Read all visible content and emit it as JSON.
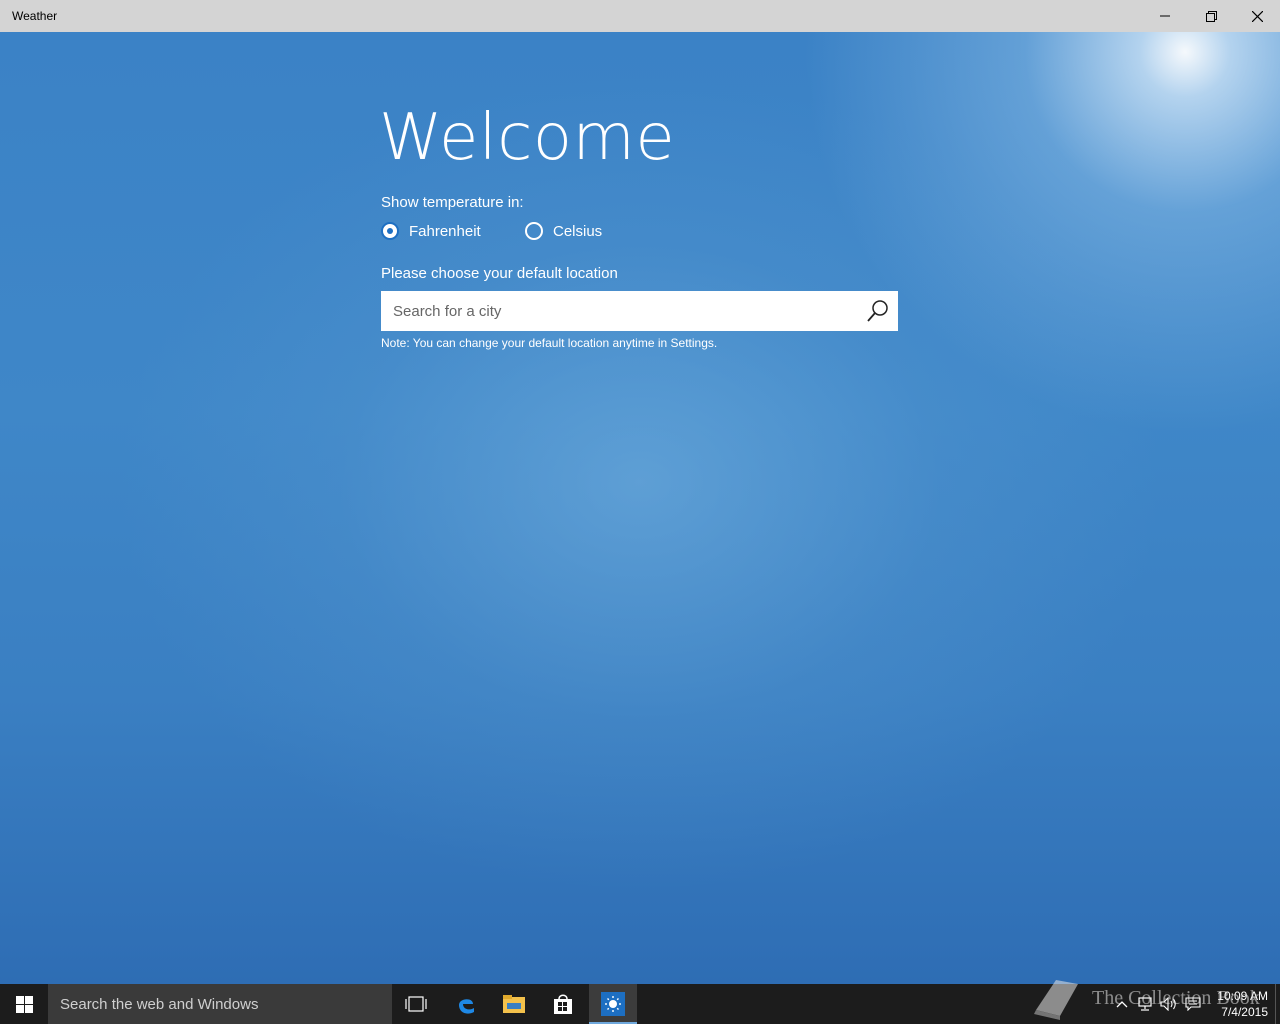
{
  "window": {
    "title": "Weather",
    "controls": {
      "minimize": "minimize-icon",
      "restore": "restore-icon",
      "close": "close-icon"
    }
  },
  "main": {
    "heading": "Welcome",
    "temperature_label": "Show temperature in:",
    "units": [
      {
        "label": "Fahrenheit",
        "selected": true
      },
      {
        "label": "Celsius",
        "selected": false
      }
    ],
    "location_label": "Please choose your default location",
    "search": {
      "placeholder": "Search for a city",
      "value": "",
      "icon": "search-icon"
    },
    "note": "Note: You can change your default location anytime in Settings."
  },
  "taskbar": {
    "search_placeholder": "Search the web and Windows",
    "pinned": [
      "task-view-icon",
      "edge-icon",
      "file-explorer-icon",
      "store-icon",
      "weather-icon"
    ],
    "active_app": "weather-icon",
    "clock": {
      "time": "10:09 AM",
      "date": "7/4/2015"
    },
    "tray": [
      "chevron-up-icon",
      "network-icon",
      "volume-icon",
      "action-center-icon"
    ]
  },
  "watermark": {
    "text": "The Collection Book",
    "icon": "book-icon"
  },
  "colors": {
    "accent": "#1d6fc2",
    "background": "#3b82c6",
    "taskbar": "#1c1c1c",
    "titlebar": "#d4d4d4"
  }
}
